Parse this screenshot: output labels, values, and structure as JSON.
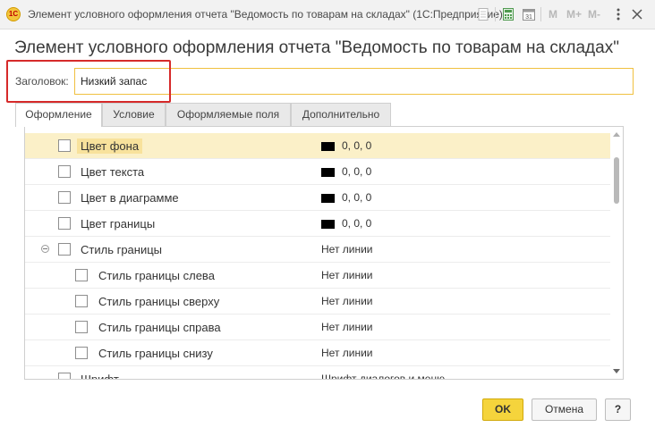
{
  "window": {
    "logo_text": "1С",
    "title": "Элемент условного оформления отчета \"Ведомость по товарам на складах\"  (1С:Предприятие)",
    "toolbar": {
      "m_label": "M",
      "m_plus_label": "M+",
      "m_minus_label": "M-",
      "calendar_day": "31"
    }
  },
  "form": {
    "title": "Элемент условного оформления отчета \"Ведомость по товарам на складах\"",
    "caption_label": "Заголовок:",
    "caption_value": "Низкий запас"
  },
  "tabs": [
    {
      "label": "Оформление",
      "active": true
    },
    {
      "label": "Условие",
      "active": false
    },
    {
      "label": "Оформляемые поля",
      "active": false
    },
    {
      "label": "Дополнительно",
      "active": false
    }
  ],
  "rows": [
    {
      "name": "Цвет фона",
      "value": "0, 0, 0"
    },
    {
      "name": "Цвет текста",
      "value": "0, 0, 0"
    },
    {
      "name": "Цвет в диаграмме",
      "value": "0, 0, 0"
    },
    {
      "name": "Цвет границы",
      "value": "0, 0, 0"
    },
    {
      "name": "Стиль границы",
      "value": "Нет линии"
    },
    {
      "name": "Стиль границы слева",
      "value": "Нет линии"
    },
    {
      "name": "Стиль границы сверху",
      "value": "Нет линии"
    },
    {
      "name": "Стиль границы справа",
      "value": "Нет линии"
    },
    {
      "name": "Стиль границы снизу",
      "value": "Нет линии"
    },
    {
      "name": "Шрифт",
      "value": "Шрифт диалогов и меню"
    }
  ],
  "buttons": {
    "ok": "OK",
    "cancel": "Отмена",
    "help": "?"
  },
  "colors": {
    "accent_yellow": "#f5d43c",
    "selected_row": "#fbf0c8",
    "annotation_red": "#d62a2a"
  }
}
